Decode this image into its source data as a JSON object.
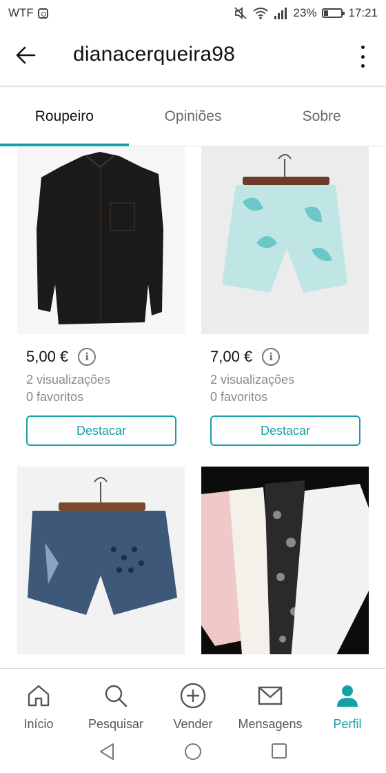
{
  "status_bar": {
    "carrier": "WTF",
    "battery": "23%",
    "battery_level": 0.23,
    "time": "17:21",
    "icons": [
      "instagram-icon",
      "mute-icon",
      "wifi-icon",
      "signal-icon",
      "battery-icon"
    ]
  },
  "header": {
    "title": "dianacerqueira98",
    "back_icon": "arrow-left-icon",
    "more_icon": "more-vertical-icon"
  },
  "tabs": [
    {
      "label": "Roupeiro",
      "active": true
    },
    {
      "label": "Opiniões",
      "active": false
    },
    {
      "label": "Sobre",
      "active": false
    }
  ],
  "items": [
    {
      "price": "5,00 €",
      "views": "2 visualizações",
      "favorites": "0 favoritos",
      "button": "Destacar",
      "image": "black-blouse-photo"
    },
    {
      "price": "7,00 €",
      "views": "2 visualizações",
      "favorites": "0 favoritos",
      "button": "Destacar",
      "image": "paisley-shorts-photo"
    },
    {
      "image": "denim-shorts-photo"
    },
    {
      "image": "jeans-pile-photo"
    }
  ],
  "bottom_nav": [
    {
      "label": "Início",
      "icon": "home-icon",
      "active": false
    },
    {
      "label": "Pesquisar",
      "icon": "search-icon",
      "active": false
    },
    {
      "label": "Vender",
      "icon": "plus-circle-icon",
      "active": false
    },
    {
      "label": "Mensagens",
      "icon": "mail-icon",
      "active": false
    },
    {
      "label": "Perfil",
      "icon": "person-icon",
      "active": true
    }
  ],
  "colors": {
    "accent": "#15a0a8",
    "text": "#111111",
    "muted": "#8a8a8a"
  }
}
